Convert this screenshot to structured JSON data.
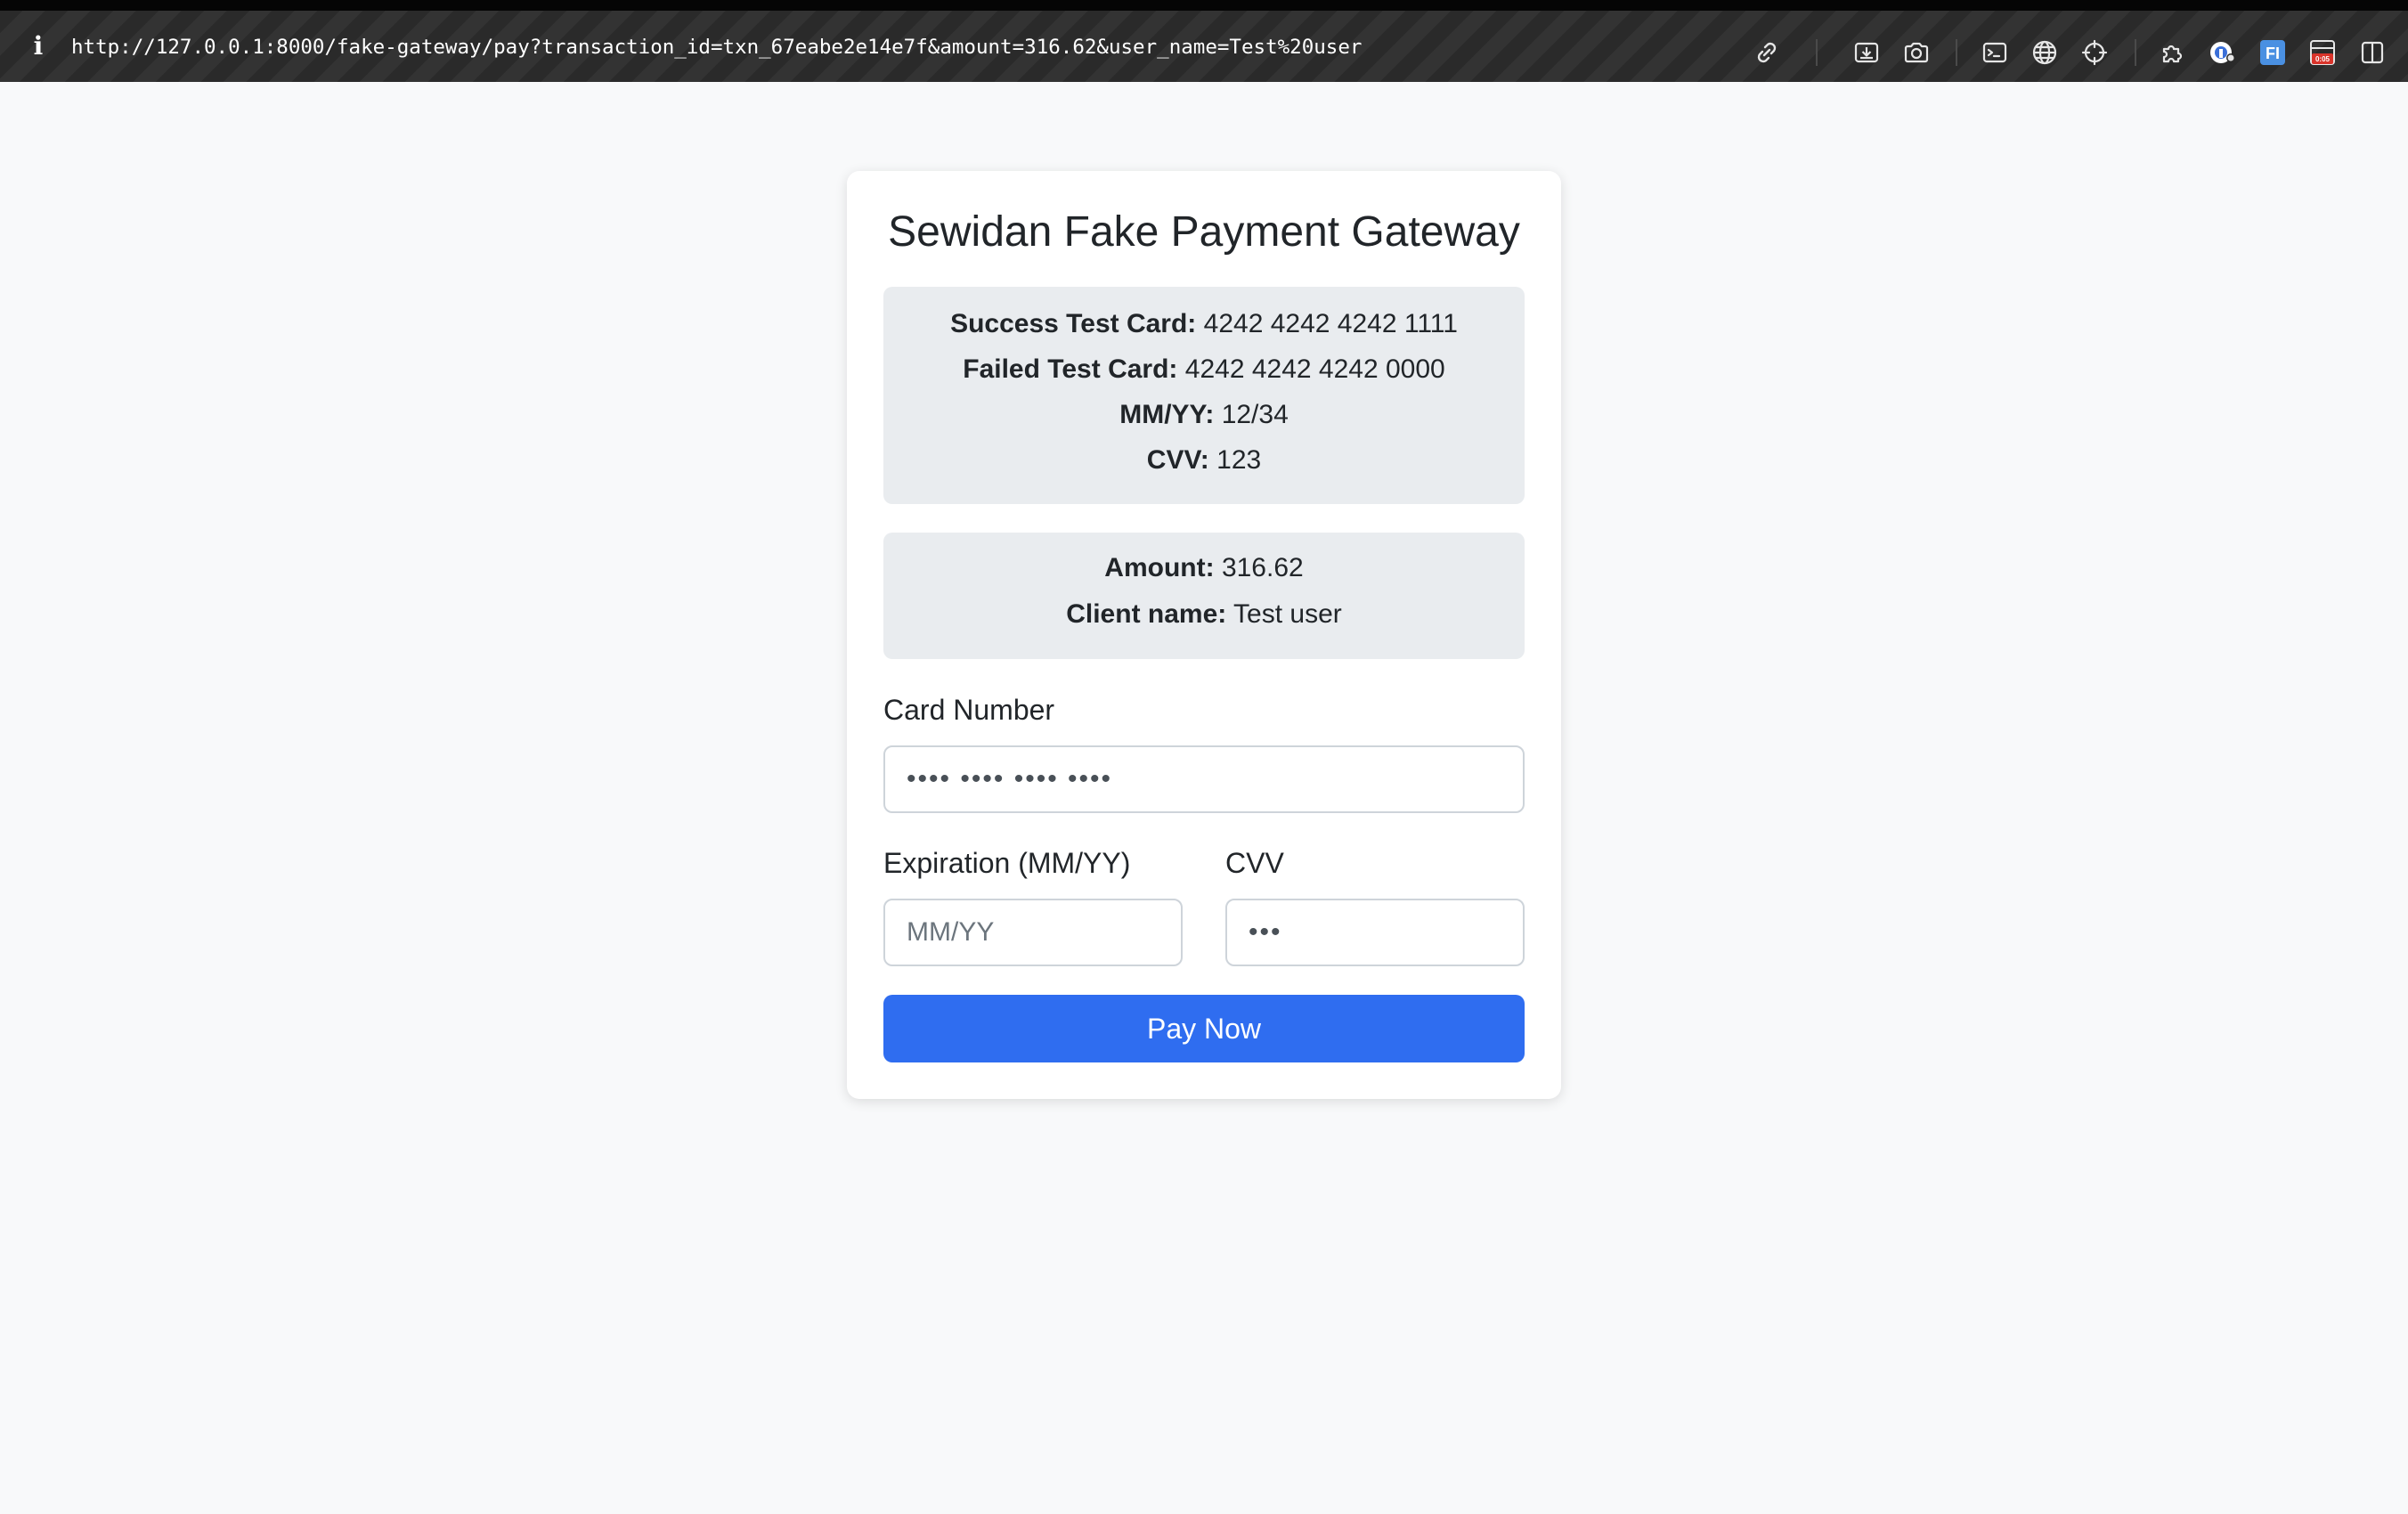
{
  "browser": {
    "info_glyph": "i",
    "url": "http://127.0.0.1:8000/fake-gateway/pay?transaction_id=txn_67eabe2e14e7f&amount=316.62&user_name=Test%20user",
    "toolbar_icons": [
      "link-icon",
      "download-icon",
      "camera-icon",
      "terminal-icon",
      "globe-icon",
      "crosshair-icon",
      "extension-icon",
      "lastpass-icon",
      "fi-icon",
      "recorder-icon",
      "sidebar-icon"
    ],
    "fi_badge": "FI",
    "recorder_badge": "0:05"
  },
  "page": {
    "title": "Sewidan Fake Payment Gateway",
    "test_cards": [
      {
        "label": "Success Test Card:",
        "value": "4242 4242 4242 1111"
      },
      {
        "label": "Failed Test Card:",
        "value": "4242 4242 4242 0000"
      },
      {
        "label": "MM/YY:",
        "value": "12/34"
      },
      {
        "label": "CVV:",
        "value": "123"
      }
    ],
    "summary": [
      {
        "label": "Amount:",
        "value": "316.62"
      },
      {
        "label": "Client name:",
        "value": "Test user"
      }
    ],
    "form": {
      "card_number_label": "Card Number",
      "card_number_placeholder": "•••• •••• •••• ••••",
      "expiration_label": "Expiration (MM/YY)",
      "expiration_placeholder": "MM/YY",
      "cvv_label": "CVV",
      "cvv_placeholder": "•••",
      "submit_label": "Pay Now"
    }
  },
  "colors": {
    "primary_button": "#2f6df0",
    "panel_background": "#e9ecef",
    "page_background": "#f8f9fa"
  }
}
